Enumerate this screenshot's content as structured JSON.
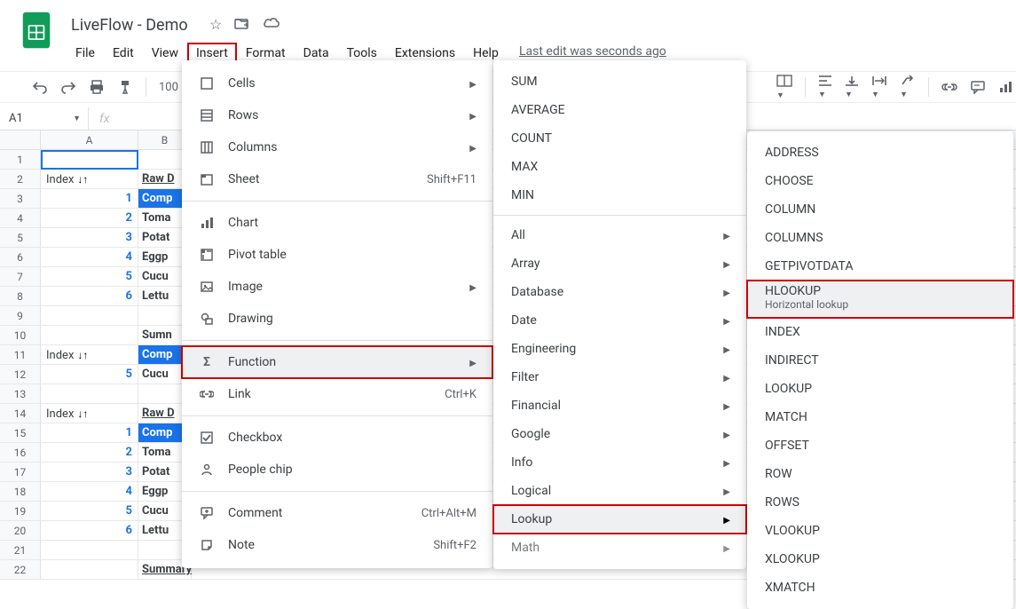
{
  "doc": {
    "title": "LiveFlow - Demo"
  },
  "top_icons": {
    "star": "☆",
    "move": "⟶",
    "cloud": "☁"
  },
  "menubar": [
    "File",
    "Edit",
    "View",
    "Insert",
    "Format",
    "Data",
    "Tools",
    "Extensions",
    "Help"
  ],
  "menubar_open": "Insert",
  "last_edit": "Last edit was seconds ago",
  "toolbar": {
    "zoom": "100"
  },
  "namebox": "A1",
  "fx": "fx",
  "columns": [
    "A",
    "B"
  ],
  "rownums": [
    "1",
    "2",
    "3",
    "4",
    "5",
    "6",
    "7",
    "8",
    "9",
    "10",
    "11",
    "12",
    "13",
    "14",
    "15",
    "16",
    "17",
    "18",
    "19",
    "20",
    "21",
    "22"
  ],
  "cells": {
    "index_label": "Index",
    "raw_label": "Raw D",
    "summary_label": "Summary",
    "arrows": "↓↑",
    "comp_prefix": "Comp",
    "items": {
      "toma": "Toma",
      "potat": "Potat",
      "eggp": "Eggp",
      "cucu": "Cucu",
      "lettu": "Lettu"
    },
    "numbers": [
      "1",
      "2",
      "3",
      "4",
      "5",
      "6"
    ],
    "number5": "5",
    "sumn": "Sumn"
  },
  "insert_menu": {
    "cells": "Cells",
    "rows": "Rows",
    "columns": "Columns",
    "sheet": "Sheet",
    "sheet_accel": "Shift+F11",
    "chart": "Chart",
    "pivot": "Pivot table",
    "image": "Image",
    "drawing": "Drawing",
    "function": "Function",
    "link": "Link",
    "link_accel": "Ctrl+K",
    "checkbox": "Checkbox",
    "people": "People chip",
    "comment": "Comment",
    "comment_accel": "Ctrl+Alt+M",
    "note": "Note",
    "note_accel": "Shift+F2"
  },
  "function_menu": {
    "sum": "SUM",
    "average": "AVERAGE",
    "count": "COUNT",
    "max": "MAX",
    "min": "MIN",
    "all": "All",
    "array": "Array",
    "database": "Database",
    "date": "Date",
    "engineering": "Engineering",
    "filter": "Filter",
    "financial": "Financial",
    "google": "Google",
    "info": "Info",
    "logical": "Logical",
    "lookup": "Lookup",
    "math": "Math"
  },
  "lookup_menu": {
    "items": [
      "ADDRESS",
      "CHOOSE",
      "COLUMN",
      "COLUMNS",
      "GETPIVOTDATA",
      "HLOOKUP",
      "INDEX",
      "INDIRECT",
      "LOOKUP",
      "MATCH",
      "OFFSET",
      "ROW",
      "ROWS",
      "VLOOKUP",
      "XLOOKUP",
      "XMATCH"
    ],
    "hlookup_desc": "Horizontal lookup"
  }
}
